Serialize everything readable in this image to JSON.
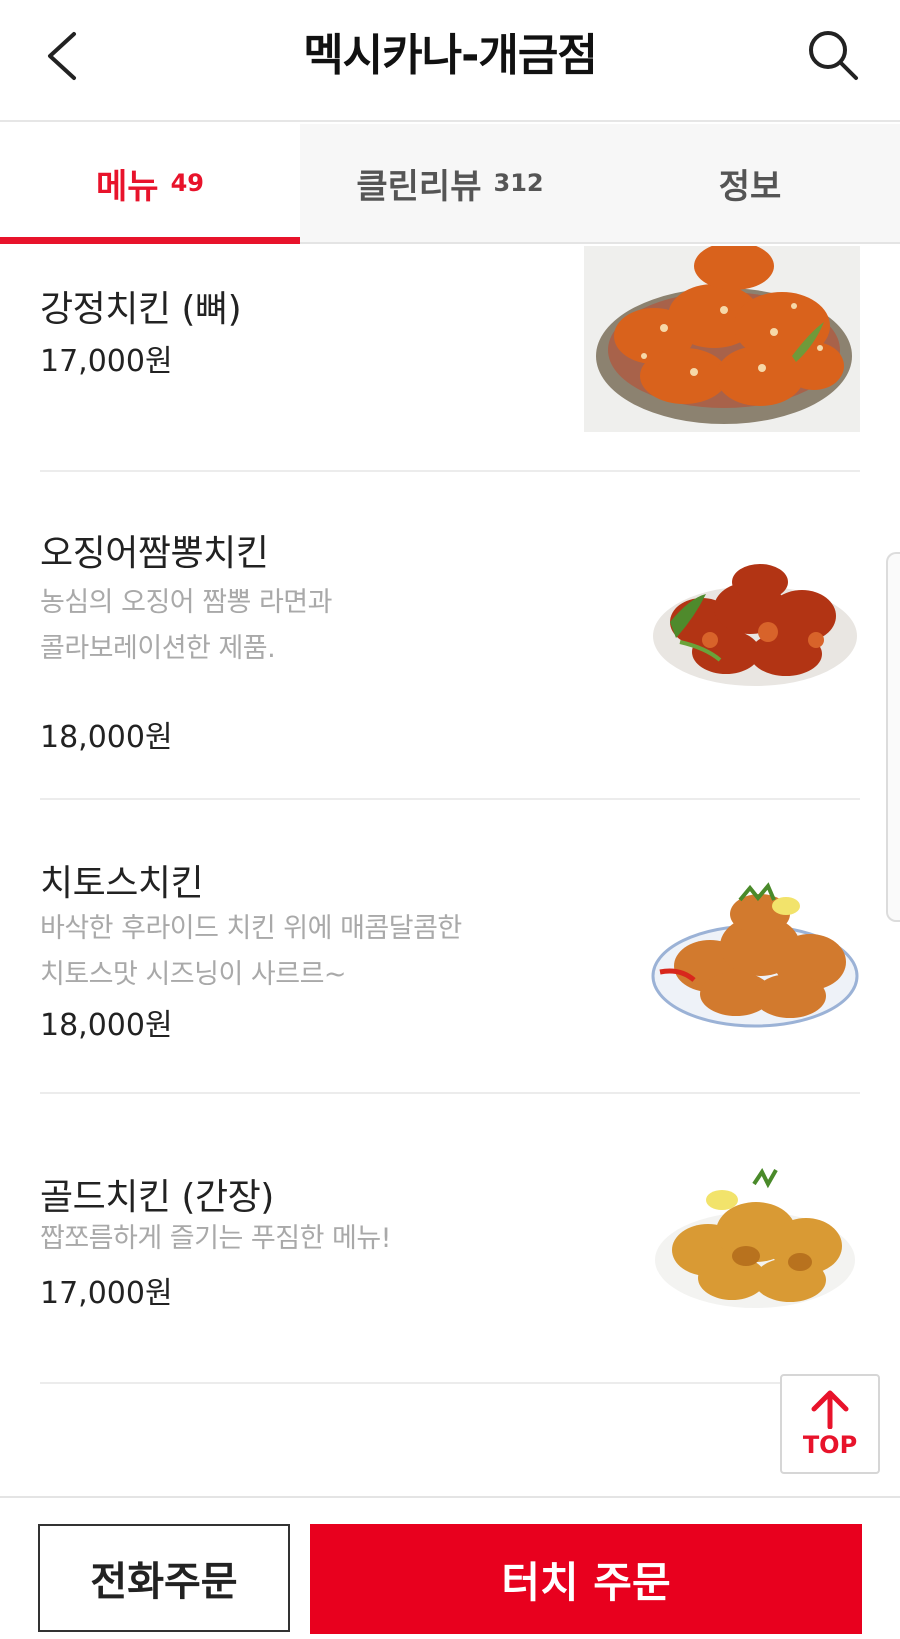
{
  "header": {
    "title": "멕시카나-개금점",
    "back_icon": "chevron-left-icon",
    "search_icon": "search-icon"
  },
  "tabs": [
    {
      "label": "메뉴",
      "count": "49",
      "active": true
    },
    {
      "label": "클린리뷰",
      "count": "312",
      "active": false
    },
    {
      "label": "정보",
      "count": "",
      "active": false
    }
  ],
  "menu": {
    "items": [
      {
        "name": "강정치킨 (뼈)",
        "description": "",
        "price": "17,000원",
        "image": "sweet-crispy-chicken-plate"
      },
      {
        "name": "오징어짬뽕치킨",
        "description": "농심의 오징어 짬뽕 라면과\n콜라보레이션한 제품.",
        "price": "18,000원",
        "image": "spicy-red-chicken-plate"
      },
      {
        "name": "치토스치킨",
        "description": "바삭한 후라이드 치킨 위에 매콤달콤한\n치토스맛 시즈닝이 사르르~",
        "price": "18,000원",
        "image": "seasoned-fried-chicken-plate"
      },
      {
        "name": "골드치킨 (간장)",
        "description": "짭쪼름하게 즐기는 푸짐한 메뉴!",
        "price": "17,000원",
        "image": "soy-golden-chicken-plate"
      }
    ]
  },
  "top_button": {
    "label": "TOP",
    "icon": "arrow-up-icon"
  },
  "bottom_bar": {
    "phone_order": "전화주문",
    "touch_order": "터치 주문"
  },
  "colors": {
    "accent": "#e8132b",
    "order_button": "#e8001e",
    "muted_text": "#a9a9a9"
  }
}
